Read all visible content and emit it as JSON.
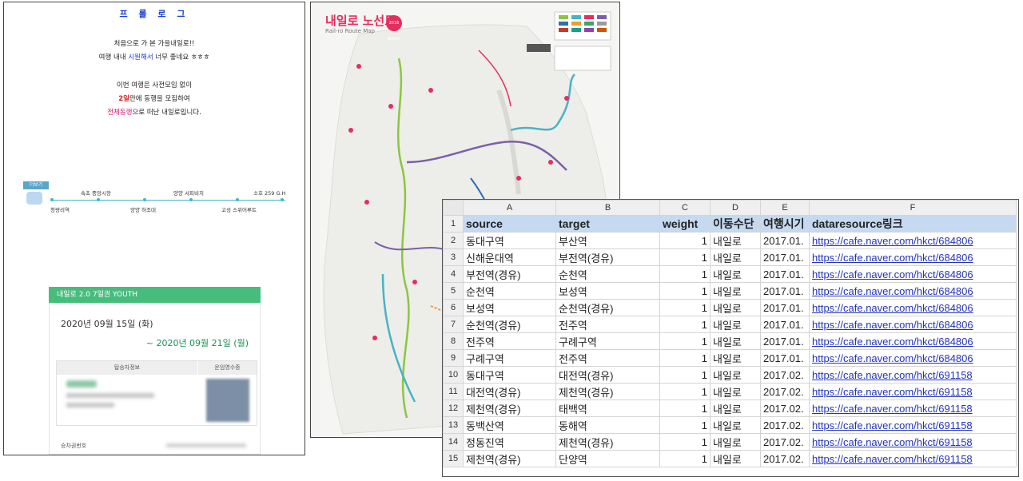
{
  "blog": {
    "title": "프 롤 로 그",
    "intro": {
      "l1": "처음으로 가 본 가을내일로!!",
      "l2a": "여행 내내 ",
      "l2b": "시원해서",
      "l2c": " 너무 좋네요 ㅎㅎㅎ"
    },
    "body": {
      "l1": "이번 여행은 사전모임 없이",
      "l2a": "2일",
      "l2b": "만에 동행을 모집하여",
      "l3a": "전체동행",
      "l3b": "으로 떠난 내일로입니다."
    },
    "route": {
      "badge": "더보기",
      "stops_top": [
        "속초 중앙시장",
        "양양 서피비치",
        "소호 259 G.H"
      ],
      "stops_bottom": [
        "청량리역",
        "양양 하조대",
        "고성 스위어루트"
      ]
    },
    "ticket": {
      "header": "내일로 2.0 7일권 YOUTH",
      "date_start": "2020년 09월 15일 (화)",
      "date_end": "~ 2020년 09월 21일 (월)",
      "col_passenger": "탑승자정보",
      "col_receipt": "운임영수증",
      "footer_label": "승차권번호"
    }
  },
  "map": {
    "title": "내일로 노선도",
    "subtitle": "Rail-ro Route Map",
    "year_badge": "2016 Winter"
  },
  "sheet": {
    "columns": [
      "A",
      "B",
      "C",
      "D",
      "E",
      "F"
    ],
    "header_row": [
      "source",
      "target",
      "weight",
      "이동수단",
      "여행시기",
      "dataresource링크"
    ],
    "rows": [
      [
        "동대구역",
        "부산역",
        "1",
        "내일로",
        "2017.01.",
        "https://cafe.naver.com/hkct/684806"
      ],
      [
        "신해운대역",
        "부전역(경유)",
        "1",
        "내일로",
        "2017.01.",
        "https://cafe.naver.com/hkct/684806"
      ],
      [
        "부전역(경유)",
        "순천역",
        "1",
        "내일로",
        "2017.01.",
        "https://cafe.naver.com/hkct/684806"
      ],
      [
        "순천역",
        "보성역",
        "1",
        "내일로",
        "2017.01.",
        "https://cafe.naver.com/hkct/684806"
      ],
      [
        "보성역",
        "순천역(경유)",
        "1",
        "내일로",
        "2017.01.",
        "https://cafe.naver.com/hkct/684806"
      ],
      [
        "순천역(경유)",
        "전주역",
        "1",
        "내일로",
        "2017.01.",
        "https://cafe.naver.com/hkct/684806"
      ],
      [
        "전주역",
        "구례구역",
        "1",
        "내일로",
        "2017.01.",
        "https://cafe.naver.com/hkct/684806"
      ],
      [
        "구례구역",
        "전주역",
        "1",
        "내일로",
        "2017.01.",
        "https://cafe.naver.com/hkct/684806"
      ],
      [
        "동대구역",
        "대전역(경유)",
        "1",
        "내일로",
        "2017.02.",
        "https://cafe.naver.com/hkct/691158"
      ],
      [
        "대전역(경유)",
        "제천역(경유)",
        "1",
        "내일로",
        "2017.02.",
        "https://cafe.naver.com/hkct/691158"
      ],
      [
        "제천역(경유)",
        "태백역",
        "1",
        "내일로",
        "2017.02.",
        "https://cafe.naver.com/hkct/691158"
      ],
      [
        "동백산역",
        "동해역",
        "1",
        "내일로",
        "2017.02.",
        "https://cafe.naver.com/hkct/691158"
      ],
      [
        "정동진역",
        "제천역(경유)",
        "1",
        "내일로",
        "2017.02.",
        "https://cafe.naver.com/hkct/691158"
      ],
      [
        "제천역(경유)",
        "단양역",
        "1",
        "내일로",
        "2017.02.",
        "https://cafe.naver.com/hkct/691158"
      ]
    ]
  }
}
